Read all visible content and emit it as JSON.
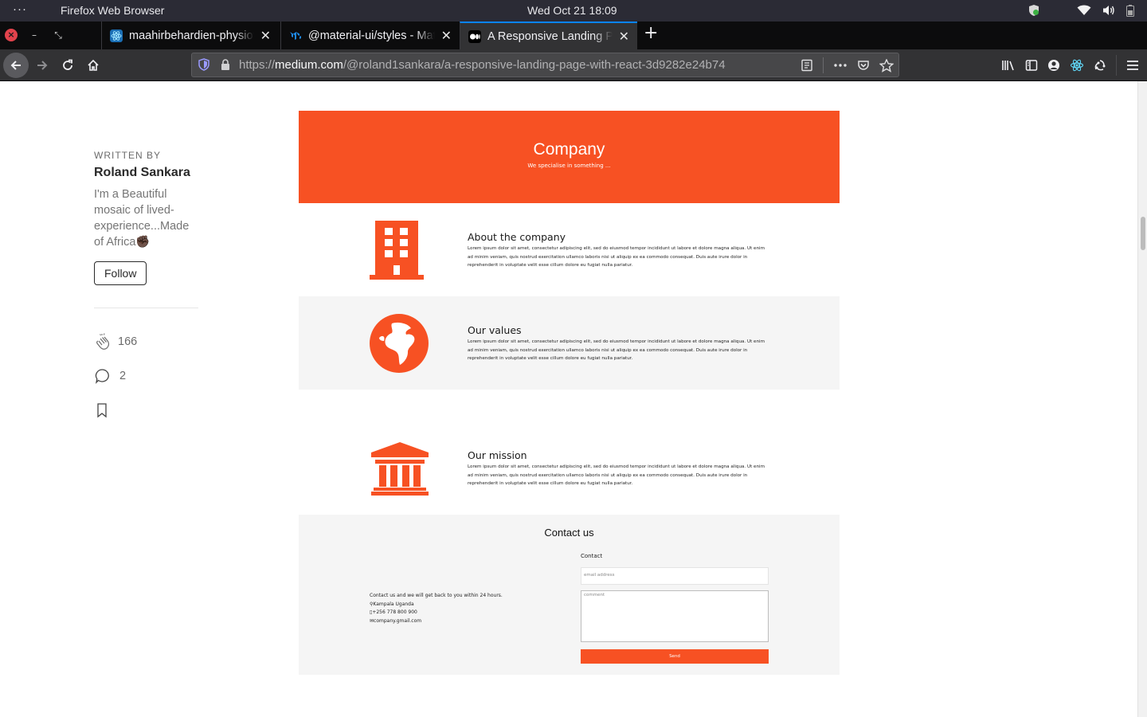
{
  "system_bar": {
    "activities": "···",
    "app_name": "Firefox Web Browser",
    "clock": "Wed Oct 21  18:09"
  },
  "tabs": [
    {
      "title": "maahirbehardien-physiot",
      "favicon": "react-icon",
      "active": false
    },
    {
      "title": "@material-ui/styles - Mat",
      "favicon": "material-ui-icon",
      "active": false
    },
    {
      "title": "A Responsive Landing Pa",
      "favicon": "medium-icon",
      "active": true
    }
  ],
  "url": {
    "scheme": "https://",
    "host": "medium.com",
    "path": "/@roland1sankara/a-responsive-landing-page-with-react-3d9282e24b74"
  },
  "author": {
    "written_by": "WRITTEN BY",
    "name": "Roland Sankara",
    "bio": "I'm a Beautiful mosaic of lived-experience...Made of Africa✊🏿",
    "follow_label": "Follow",
    "claps": "166",
    "responses": "2"
  },
  "landing": {
    "accent_color": "#f75123",
    "hero_title": "Company",
    "hero_subtitle": "We specialise in something ...",
    "features": [
      {
        "title": "About the company",
        "icon": "building-icon",
        "text": "Lorem ipsum dolor sit amet, consectetur adipiscing elit, sed do eiusmod tempor incididunt ut labore et dolore magna aliqua. Ut enim ad minim veniam, quis nostrud exercitation ullamco laboris nisi ut aliquip ex ea commodo consequat. Duis aute irure dolor in reprehenderit in voluptate velit esse cillum dolore eu fugiat nulla pariatur."
      },
      {
        "title": "Our values",
        "icon": "globe-africa-icon",
        "text": "Lorem ipsum dolor sit amet, consectetur adipiscing elit, sed do eiusmod tempor incididunt ut labore et dolore magna aliqua. Ut enim ad minim veniam, quis nostrud exercitation ullamco laboris nisi ut aliquip ex ea commodo consequat. Duis aute irure dolor in reprehenderit in voluptate velit esse cillum dolore eu fugiat nulla pariatur."
      },
      {
        "title": "Our mission",
        "icon": "institution-icon",
        "text": "Lorem ipsum dolor sit amet, consectetur adipiscing elit, sed do eiusmod tempor incididunt ut labore et dolore magna aliqua. Ut enim ad minim veniam, quis nostrud exercitation ullamco laboris nisi ut aliquip ex ea commodo consequat. Duis aute irure dolor in reprehenderit in voluptate velit esse cillum dolore eu fugiat nulla pariatur."
      }
    ],
    "contact": {
      "title": "Contact us",
      "intro": "Contact us and we will get back to you within 24 hours.",
      "location": "Kampala Uganda",
      "phone": "+256 778 800 900",
      "email": "company.gmail.com",
      "form_label": "Contact",
      "email_placeholder": "email address",
      "comment_placeholder": "comment",
      "send_label": "Send"
    }
  }
}
